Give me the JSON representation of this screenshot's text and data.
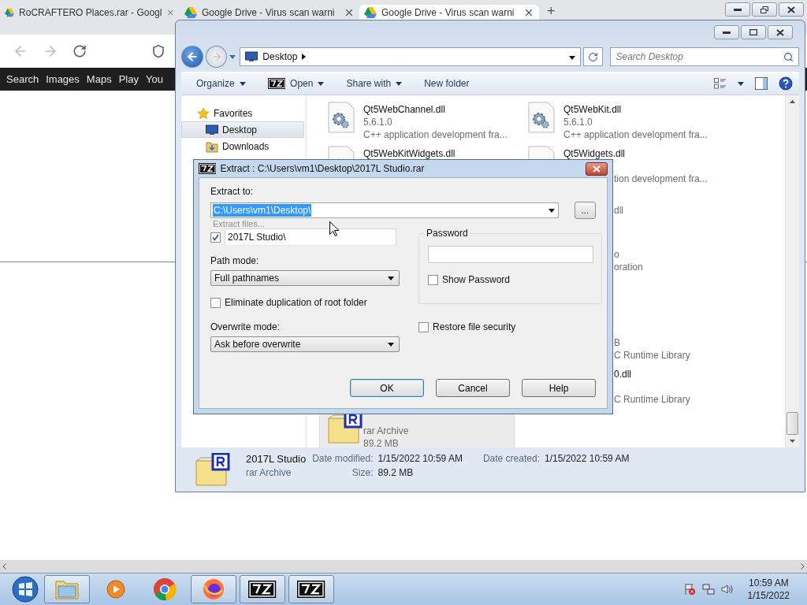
{
  "browser": {
    "tabs": [
      {
        "title": "RoCRAFTERO Places.rar - Googl",
        "selected": false
      },
      {
        "title": "Google Drive - Virus scan warni",
        "selected": false
      },
      {
        "title": "Google Drive - Virus scan warni",
        "selected": true
      }
    ],
    "new_tab": "+",
    "links": [
      "Search",
      "Images",
      "Maps",
      "Play",
      "You"
    ]
  },
  "explorer": {
    "address": "Desktop",
    "search": {
      "placeholder": "Search Desktop"
    },
    "toolbar": [
      {
        "label": "Organize",
        "kind": "menu"
      },
      {
        "label": "Open",
        "kind": "app"
      },
      {
        "label": "Share with",
        "kind": "menu"
      },
      {
        "label": "New folder",
        "kind": "plain"
      }
    ],
    "sidebar": [
      {
        "label": "Favorites",
        "kind": "star",
        "selected": false
      },
      {
        "label": "Desktop",
        "kind": "desktop",
        "selected": true
      },
      {
        "label": "Downloads",
        "kind": "downloads",
        "selected": false
      }
    ],
    "files": [
      {
        "cells": [
          {
            "kind": "dll",
            "selected": false,
            "name": "Qt5WebChannel.dll",
            "version": "5.6.1.0",
            "description": "C++ application development fra..."
          },
          {
            "kind": "dll",
            "selected": false,
            "name": "Qt5WebKit.dll",
            "version": "5.6.1.0",
            "description": "C++ application development fra..."
          }
        ]
      },
      {
        "cells": [
          {
            "kind": "dll_partial",
            "selected": false,
            "name": "Qt5WebKitWidgets.dll"
          },
          {
            "kind": "dll_partial",
            "selected": false,
            "name": "Qt5Widgets.dll",
            "description": "tion development fra..."
          }
        ]
      },
      {
        "cells": [
          {
            "kind": "none"
          },
          {
            "kind": "covered",
            "version": "dll"
          }
        ]
      },
      {
        "cells": [
          {
            "kind": "none"
          },
          {
            "kind": "covered",
            "version": "o",
            "description": "oration"
          }
        ]
      },
      {
        "cells": [
          {
            "kind": "none"
          },
          {
            "kind": "none"
          }
        ]
      },
      {
        "cells": [
          {
            "kind": "none"
          },
          {
            "kind": "covered",
            "version": "B",
            "description": "C Runtime Library"
          }
        ]
      },
      {
        "cells": [
          {
            "kind": "none"
          },
          {
            "kind": "covered",
            "name": "0.dll",
            "description": "C Runtime Library"
          }
        ]
      },
      {
        "cells": [
          {
            "kind": "archive",
            "selected": true,
            "version": "rar Archive",
            "description": "89.2 MB"
          },
          {
            "kind": "none"
          }
        ]
      }
    ],
    "details": {
      "name": "2017L Studio",
      "type": "rar Archive",
      "modified_label": "Date modified:",
      "modified": "1/15/2022 10:59 AM",
      "created_label": "Date created:",
      "created": "1/15/2022 10:59 AM",
      "size_label": "Size:",
      "size": "89.2 MB"
    }
  },
  "dialog": {
    "title": "Extract : C:\\Users\\vm1\\Desktop\\2017L Studio.rar",
    "extract_label": "Extract to:",
    "extract_to": {
      "value": "C:\\Users\\vm1\\Desktop\\",
      "selected": true
    },
    "browse": "...",
    "hint": "Extract files...",
    "subfolder": {
      "checked": true,
      "value": "2017L Studio\\"
    },
    "path_label": "Path mode:",
    "path_mode": "Full pathnames",
    "eliminate": {
      "label": "Eliminate duplication of root folder",
      "checked": false
    },
    "overwrite_label": "Overwrite mode:",
    "overwrite_mode": "Ask before overwrite",
    "password_label": "Password",
    "show_password": {
      "label": "Show Password",
      "checked": false
    },
    "restore": {
      "label": "Restore file security",
      "checked": false
    },
    "buttons": [
      {
        "label": "OK",
        "default": true
      },
      {
        "label": "Cancel",
        "default": false
      },
      {
        "label": "Help",
        "default": false
      }
    ]
  },
  "taskbar": {
    "apps": [
      {
        "kind": "explorer",
        "running": true
      },
      {
        "kind": "media",
        "running": false
      },
      {
        "kind": "chrome",
        "running": false
      },
      {
        "kind": "firefox",
        "running": true
      },
      {
        "kind": "sevenzip",
        "running": true
      },
      {
        "kind": "sevenzip",
        "running": true
      }
    ],
    "time": "10:59 AM",
    "date": "1/15/2022"
  }
}
